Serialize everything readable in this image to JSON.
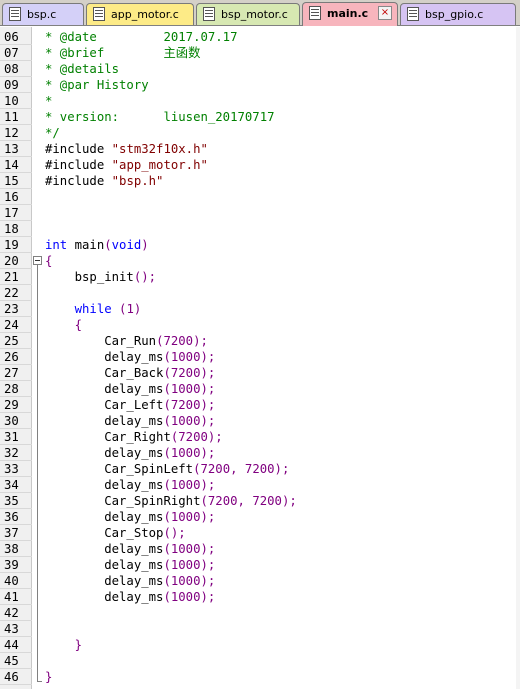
{
  "tabs": [
    {
      "label": "bsp.c",
      "color": "#d4d0f8",
      "active": false,
      "close": false
    },
    {
      "label": "app_motor.c",
      "color": "#fdeb87",
      "active": false,
      "close": false
    },
    {
      "label": "bsp_motor.c",
      "color": "#d7e8b2",
      "active": false,
      "close": false
    },
    {
      "label": "main.c",
      "color": "#f7b5bd",
      "active": true,
      "close": true
    },
    {
      "label": "bsp_gpio.c",
      "color": "#d6c4f3",
      "active": false,
      "close": false
    }
  ],
  "close_glyph": "×",
  "lines": [
    {
      "n": "06",
      "parts": [
        {
          "t": "* @date         2017.07.17",
          "c": "comment"
        }
      ]
    },
    {
      "n": "07",
      "parts": [
        {
          "t": "* @brief        ",
          "c": "comment"
        },
        {
          "t": "主函数",
          "c": "comment cjk"
        }
      ]
    },
    {
      "n": "08",
      "parts": [
        {
          "t": "* @details",
          "c": "comment"
        }
      ]
    },
    {
      "n": "09",
      "parts": [
        {
          "t": "* @par History",
          "c": "comment"
        }
      ]
    },
    {
      "n": "10",
      "parts": [
        {
          "t": "*",
          "c": "comment"
        }
      ]
    },
    {
      "n": "11",
      "parts": [
        {
          "t": "* version:      liusen_20170717",
          "c": "comment"
        }
      ]
    },
    {
      "n": "12",
      "parts": [
        {
          "t": "*/",
          "c": "comment"
        }
      ]
    },
    {
      "n": "13",
      "parts": [
        {
          "t": "#include ",
          "c": "txt"
        },
        {
          "t": "\"stm32f10x.h\"",
          "c": "str"
        }
      ]
    },
    {
      "n": "14",
      "parts": [
        {
          "t": "#include ",
          "c": "txt"
        },
        {
          "t": "\"app_motor.h\"",
          "c": "str"
        }
      ]
    },
    {
      "n": "15",
      "parts": [
        {
          "t": "#include ",
          "c": "txt"
        },
        {
          "t": "\"bsp.h\"",
          "c": "str"
        }
      ]
    },
    {
      "n": "16",
      "parts": []
    },
    {
      "n": "17",
      "parts": []
    },
    {
      "n": "18",
      "parts": []
    },
    {
      "n": "19",
      "parts": [
        {
          "t": "int",
          "c": "kw"
        },
        {
          "t": " main",
          "c": "txt"
        },
        {
          "t": "(",
          "c": "punc"
        },
        {
          "t": "void",
          "c": "kw"
        },
        {
          "t": ")",
          "c": "punc"
        }
      ]
    },
    {
      "n": "20",
      "parts": [
        {
          "t": "{",
          "c": "punc"
        }
      ]
    },
    {
      "n": "21",
      "parts": [
        {
          "t": "    bsp_init",
          "c": "txt"
        },
        {
          "t": "();",
          "c": "punc"
        }
      ]
    },
    {
      "n": "22",
      "parts": []
    },
    {
      "n": "23",
      "parts": [
        {
          "t": "    ",
          "c": "txt"
        },
        {
          "t": "while",
          "c": "kw"
        },
        {
          "t": " (",
          "c": "punc"
        },
        {
          "t": "1",
          "c": "num"
        },
        {
          "t": ")",
          "c": "punc"
        }
      ]
    },
    {
      "n": "24",
      "parts": [
        {
          "t": "    {",
          "c": "punc"
        }
      ]
    },
    {
      "n": "25",
      "parts": [
        {
          "t": "        Car_Run",
          "c": "txt"
        },
        {
          "t": "(",
          "c": "punc"
        },
        {
          "t": "7200",
          "c": "num"
        },
        {
          "t": ");",
          "c": "punc"
        }
      ]
    },
    {
      "n": "26",
      "parts": [
        {
          "t": "        delay_ms",
          "c": "txt"
        },
        {
          "t": "(",
          "c": "punc"
        },
        {
          "t": "1000",
          "c": "num"
        },
        {
          "t": ");",
          "c": "punc"
        }
      ]
    },
    {
      "n": "27",
      "parts": [
        {
          "t": "        Car_Back",
          "c": "txt"
        },
        {
          "t": "(",
          "c": "punc"
        },
        {
          "t": "7200",
          "c": "num"
        },
        {
          "t": ");",
          "c": "punc"
        }
      ]
    },
    {
      "n": "28",
      "parts": [
        {
          "t": "        delay_ms",
          "c": "txt"
        },
        {
          "t": "(",
          "c": "punc"
        },
        {
          "t": "1000",
          "c": "num"
        },
        {
          "t": ");",
          "c": "punc"
        }
      ]
    },
    {
      "n": "29",
      "parts": [
        {
          "t": "        Car_Left",
          "c": "txt"
        },
        {
          "t": "(",
          "c": "punc"
        },
        {
          "t": "7200",
          "c": "num"
        },
        {
          "t": ");",
          "c": "punc"
        }
      ]
    },
    {
      "n": "30",
      "parts": [
        {
          "t": "        delay_ms",
          "c": "txt"
        },
        {
          "t": "(",
          "c": "punc"
        },
        {
          "t": "1000",
          "c": "num"
        },
        {
          "t": ");",
          "c": "punc"
        }
      ]
    },
    {
      "n": "31",
      "parts": [
        {
          "t": "        Car_Right",
          "c": "txt"
        },
        {
          "t": "(",
          "c": "punc"
        },
        {
          "t": "7200",
          "c": "num"
        },
        {
          "t": ");",
          "c": "punc"
        }
      ]
    },
    {
      "n": "32",
      "parts": [
        {
          "t": "        delay_ms",
          "c": "txt"
        },
        {
          "t": "(",
          "c": "punc"
        },
        {
          "t": "1000",
          "c": "num"
        },
        {
          "t": ");",
          "c": "punc"
        }
      ]
    },
    {
      "n": "33",
      "parts": [
        {
          "t": "        Car_SpinLeft",
          "c": "txt"
        },
        {
          "t": "(",
          "c": "punc"
        },
        {
          "t": "7200",
          "c": "num"
        },
        {
          "t": ", ",
          "c": "punc"
        },
        {
          "t": "7200",
          "c": "num"
        },
        {
          "t": ");",
          "c": "punc"
        }
      ]
    },
    {
      "n": "34",
      "parts": [
        {
          "t": "        delay_ms",
          "c": "txt"
        },
        {
          "t": "(",
          "c": "punc"
        },
        {
          "t": "1000",
          "c": "num"
        },
        {
          "t": ");",
          "c": "punc"
        }
      ]
    },
    {
      "n": "35",
      "parts": [
        {
          "t": "        Car_SpinRight",
          "c": "txt"
        },
        {
          "t": "(",
          "c": "punc"
        },
        {
          "t": "7200",
          "c": "num"
        },
        {
          "t": ", ",
          "c": "punc"
        },
        {
          "t": "7200",
          "c": "num"
        },
        {
          "t": ");",
          "c": "punc"
        }
      ]
    },
    {
      "n": "36",
      "parts": [
        {
          "t": "        delay_ms",
          "c": "txt"
        },
        {
          "t": "(",
          "c": "punc"
        },
        {
          "t": "1000",
          "c": "num"
        },
        {
          "t": ");",
          "c": "punc"
        }
      ]
    },
    {
      "n": "37",
      "parts": [
        {
          "t": "        Car_Stop",
          "c": "txt"
        },
        {
          "t": "();",
          "c": "punc"
        }
      ]
    },
    {
      "n": "38",
      "parts": [
        {
          "t": "        delay_ms",
          "c": "txt"
        },
        {
          "t": "(",
          "c": "punc"
        },
        {
          "t": "1000",
          "c": "num"
        },
        {
          "t": ");",
          "c": "punc"
        }
      ]
    },
    {
      "n": "39",
      "parts": [
        {
          "t": "        delay_ms",
          "c": "txt"
        },
        {
          "t": "(",
          "c": "punc"
        },
        {
          "t": "1000",
          "c": "num"
        },
        {
          "t": ");",
          "c": "punc"
        }
      ]
    },
    {
      "n": "40",
      "parts": [
        {
          "t": "        delay_ms",
          "c": "txt"
        },
        {
          "t": "(",
          "c": "punc"
        },
        {
          "t": "1000",
          "c": "num"
        },
        {
          "t": ");",
          "c": "punc"
        }
      ]
    },
    {
      "n": "41",
      "parts": [
        {
          "t": "        delay_ms",
          "c": "txt"
        },
        {
          "t": "(",
          "c": "punc"
        },
        {
          "t": "1000",
          "c": "num"
        },
        {
          "t": ");",
          "c": "punc"
        }
      ]
    },
    {
      "n": "42",
      "parts": []
    },
    {
      "n": "43",
      "parts": []
    },
    {
      "n": "44",
      "parts": [
        {
          "t": "    }",
          "c": "punc"
        }
      ]
    },
    {
      "n": "45",
      "parts": []
    },
    {
      "n": "46",
      "parts": [
        {
          "t": "}",
          "c": "punc"
        }
      ]
    }
  ]
}
